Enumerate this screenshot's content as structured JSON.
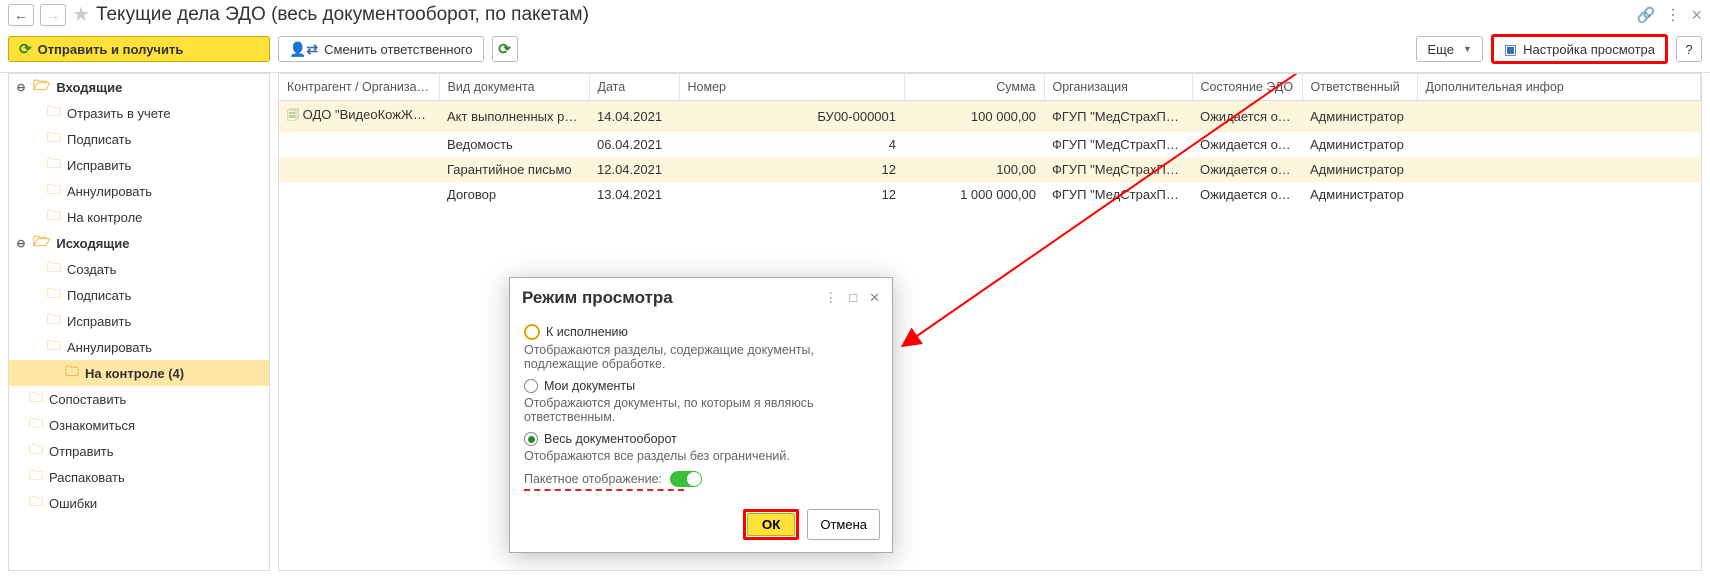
{
  "nav": {
    "back": "←",
    "fwd": "→"
  },
  "title": "Текущие дела ЭДО (весь документооборот, по пакетам)",
  "toolbar": {
    "send_receive": "Отправить и получить",
    "change_assignee": "Сменить ответственного",
    "more": "Еще",
    "view_settings": "Настройка просмотра",
    "help": "?"
  },
  "tree": {
    "incoming": "Входящие",
    "incoming_items": [
      "Отразить в учете",
      "Подписать",
      "Исправить",
      "Аннулировать",
      "На контроле"
    ],
    "outgoing": "Исходящие",
    "outgoing_items": [
      "Создать",
      "Подписать",
      "Исправить",
      "Аннулировать"
    ],
    "outgoing_sel": "На контроле (4)",
    "simple_items": [
      "Сопоставить",
      "Ознакомиться",
      "Отправить",
      "Распаковать",
      "Ошибки"
    ]
  },
  "cols": {
    "contragent": "Контрагент / Организация",
    "doctype": "Вид документа",
    "date": "Дата",
    "number": "Номер",
    "sum": "Сумма",
    "org": "Организация",
    "edo_state": "Состояние ЭДО",
    "responsible": "Ответственный",
    "addinfo": "Дополнительная инфор"
  },
  "rows": [
    {
      "c": "ОДО \"ВидеоКожЖил...",
      "t": "Акт выполненных работ",
      "d": "14.04.2021",
      "n": "БУ00-000001",
      "s": "100 000,00",
      "o": "ФГУП \"МедСтрахПро...",
      "st": "Ожидается отв...",
      "r": "Администратор"
    },
    {
      "c": "",
      "t": "Ведомость",
      "d": "06.04.2021",
      "n": "4",
      "s": "",
      "o": "ФГУП \"МедСтрахПро...",
      "st": "Ожидается отв...",
      "r": "Администратор"
    },
    {
      "c": "",
      "t": "Гарантийное письмо",
      "d": "12.04.2021",
      "n": "12",
      "s": "100,00",
      "o": "ФГУП \"МедСтрахПро...",
      "st": "Ожидается отв...",
      "r": "Администратор"
    },
    {
      "c": "",
      "t": "Договор",
      "d": "13.04.2021",
      "n": "12",
      "s": "1 000 000,00",
      "o": "ФГУП \"МедСтрахПро...",
      "st": "Ожидается отв...",
      "r": "Администратор"
    }
  ],
  "dialog": {
    "title": "Режим просмотра",
    "opt1": "К исполнению",
    "opt1_desc": "Отображаются разделы, содержащие документы, подлежащие обработке.",
    "opt2": "Мои документы",
    "opt2_desc": "Отображаются документы, по которым я являюсь ответственным.",
    "opt3": "Весь документооборот",
    "opt3_desc": "Отображаются все разделы без ограничений.",
    "batch_label": "Пакетное отображение:",
    "ok": "ОК",
    "cancel": "Отмена"
  }
}
